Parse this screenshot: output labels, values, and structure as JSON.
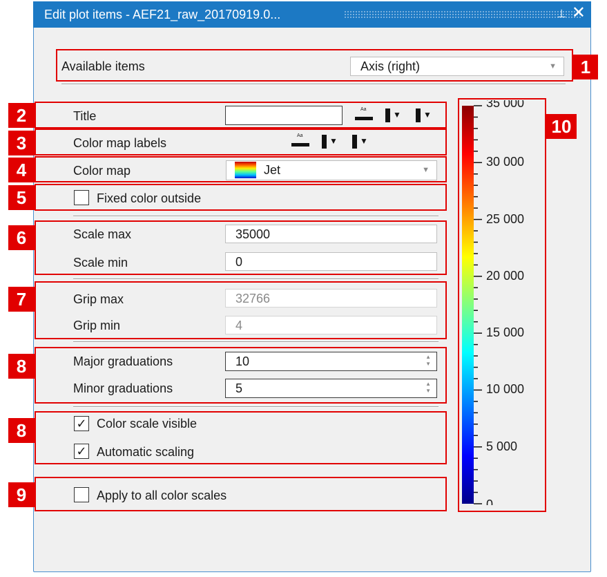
{
  "window": {
    "title": "Edit plot items - AEF21_raw_20170919.0...",
    "pin_glyph": "⊥",
    "close_glyph": "✕"
  },
  "available_items": {
    "label": "Available items",
    "value": "Axis (right)"
  },
  "title_row": {
    "label": "Title",
    "value": ""
  },
  "color_map_labels": {
    "label": "Color map labels"
  },
  "color_map": {
    "label": "Color map",
    "value": "Jet"
  },
  "fixed_color_outside": {
    "label": "Fixed color outside",
    "checked": false
  },
  "scale": {
    "max_label": "Scale max",
    "max_value": "35000",
    "min_label": "Scale min",
    "min_value": "0"
  },
  "grip": {
    "max_label": "Grip max",
    "max_value": "32766",
    "min_label": "Grip min",
    "min_value": "4"
  },
  "graduations": {
    "major_label": "Major graduations",
    "major_value": "10",
    "minor_label": "Minor graduations",
    "minor_value": "5"
  },
  "color_scale_visible": {
    "label": "Color scale visible",
    "checked": true,
    "mark": "✓"
  },
  "automatic_scaling": {
    "label": "Automatic scaling",
    "checked": true,
    "mark": "✓"
  },
  "apply_all": {
    "label": "Apply to all color scales",
    "checked": false
  },
  "badges": [
    "1",
    "2",
    "3",
    "4",
    "5",
    "6",
    "7",
    "8",
    "8",
    "9",
    "10"
  ],
  "colorbar": {
    "colormap": "jet",
    "range": [
      0,
      35000
    ],
    "tick_labels": [
      "35 000",
      "30 000",
      "25 000",
      "20 000",
      "15 000",
      "10 000",
      "5 000",
      "0"
    ]
  },
  "colors": {
    "titlebar": "#1c79c4",
    "annotation": "#e10000",
    "panel": "#f0f0f0"
  }
}
